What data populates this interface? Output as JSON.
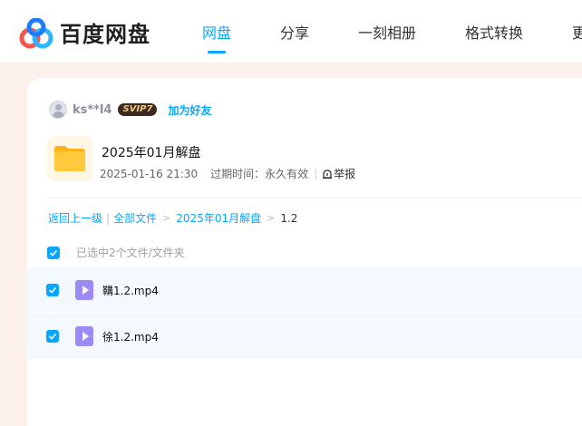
{
  "app": {
    "brand_name": "百度网盘",
    "colors": {
      "accent": "#06a7ff",
      "file_icon": "#9c8bf7",
      "folder": "#ffc43d"
    }
  },
  "nav": {
    "items": [
      {
        "label": "网盘",
        "active": true
      },
      {
        "label": "分享",
        "active": false
      },
      {
        "label": "一刻相册",
        "active": false
      },
      {
        "label": "格式转换",
        "active": false
      },
      {
        "label": "更",
        "active": false
      }
    ]
  },
  "share": {
    "username": "ks**l4",
    "vip_badge": "SVIP7",
    "add_friend_label": "加为好友",
    "title": "2025年01月解盘",
    "date": "2025-01-16 21:30",
    "expire": "过期时间：永久有效",
    "report_label": "举报"
  },
  "breadcrumb": {
    "back": "返回上一级",
    "separator": "|",
    "items": [
      "全部文件",
      "2025年01月解盘"
    ],
    "arrow": ">",
    "current": "1.2"
  },
  "selection": {
    "text": "已选中2个文件/文件夹",
    "all_checked": true
  },
  "files": [
    {
      "name": "鞲1.2.mp4",
      "checked": true,
      "icon": "video-file-icon"
    },
    {
      "name": "徐1.2.mp4",
      "checked": true,
      "icon": "video-file-icon"
    }
  ]
}
